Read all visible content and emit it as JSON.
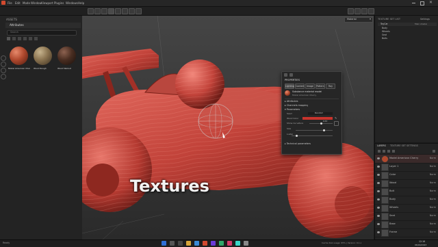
{
  "menu": [
    "File",
    "Edit",
    "Mode",
    "Window",
    "Viewport",
    "Plugins",
    "Windows",
    "Help"
  ],
  "assets_panel": {
    "title": "ASSETS",
    "section": "Attributes",
    "search_placeholder": "Search",
    "materials": [
      {
        "name": "Model American Cherry",
        "color": "#b0492e"
      },
      {
        "name": "Wood Rough",
        "color": "#8a7350"
      },
      {
        "name": "Wood Walnut",
        "color": "#4a2e22"
      }
    ]
  },
  "viewport": {
    "material_dropdown": "Material",
    "overlay_title": "Textures"
  },
  "properties": {
    "title": "PROPERTIES",
    "tabs": [
      "Lighting",
      "Content",
      "Image",
      "Pattern",
      "Ray"
    ],
    "material_name": "Substance material model",
    "material_sub": "Model American Cherry",
    "sections": [
      "Attributes",
      "Channels mapping",
      "Parameters"
    ],
    "params": [
      {
        "label": "Seed",
        "value": "Random"
      },
      {
        "label": "Wood Color",
        "value": ""
      },
      {
        "label": "Shine Curvature",
        "value": "0.53"
      },
      {
        "label": "Size",
        "value": ""
      },
      {
        "label": "Luster",
        "value": ""
      }
    ],
    "technical": "Technical parameters"
  },
  "texture_set_list": {
    "title": "TEXTURE SET LIST",
    "settings": "Settings",
    "items": [
      "ToyCar",
      "Body",
      "Wheels",
      "Seat",
      "Bolts"
    ],
    "shader": "Main shader"
  },
  "layers_panel": {
    "tabs": [
      "LAYERS",
      "TEXTURE SET SETTINGS"
    ],
    "rows": [
      {
        "name": "Model American Cherry",
        "blend": "Norm",
        "highlight": true
      },
      {
        "name": "Layer 1",
        "blend": "Norm"
      },
      {
        "name": "Color",
        "blend": "Norm"
      },
      {
        "name": "Wood",
        "blend": "Norm"
      },
      {
        "name": "Bolt",
        "blend": "Norm"
      },
      {
        "name": "Body",
        "blend": "Norm"
      },
      {
        "name": "Wheels",
        "blend": "Norm"
      },
      {
        "name": "Seat",
        "blend": "Norm"
      },
      {
        "name": "Base",
        "blend": "Norm"
      },
      {
        "name": "Frame",
        "blend": "Norm"
      },
      {
        "name": "Paint",
        "blend": "Norm"
      }
    ]
  },
  "status": {
    "left": "Ready",
    "right": "Cache disk usage: 95% | Version: 9.1.x",
    "time": "12:16",
    "date": "06/04/2023"
  },
  "colors": {
    "accent": "#c8342d",
    "wood_red": "#c2433a",
    "panel": "#232323",
    "viewport_bg": "#3a3a3a"
  }
}
